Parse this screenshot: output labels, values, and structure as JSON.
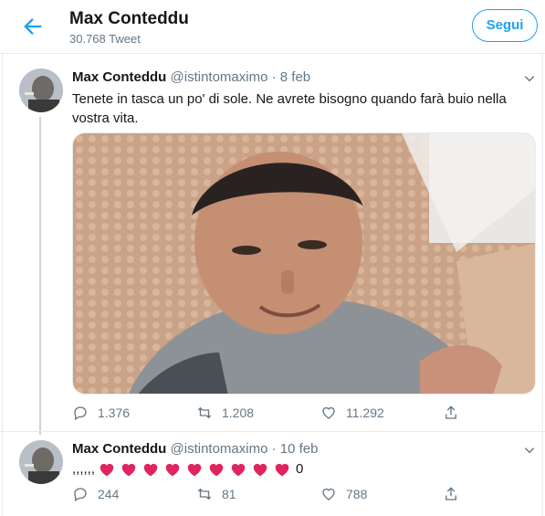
{
  "header": {
    "title": "Max Conteddu",
    "subtitle": "30.768 Tweet",
    "follow_label": "Segui"
  },
  "tweets": [
    {
      "name": "Max Conteddu",
      "handle": "@istintomaximo",
      "separator": "·",
      "date": "8 feb",
      "text": "Tenete in tasca un po' di sole. Ne avrete bisogno quando farà buio nella vostra vita.",
      "replies": "1.376",
      "retweets": "1.208",
      "likes": "11.292"
    },
    {
      "name": "Max Conteddu",
      "handle": "@istintomaximo",
      "separator": "·",
      "date": "10 feb",
      "prefix": ",,,,,,",
      "heart_count": 9,
      "suffix": "0",
      "replies": "244",
      "retweets": "81",
      "likes": "788"
    }
  ],
  "colors": {
    "accent": "#1da1f2",
    "secondary_text": "#657786",
    "heart": "#e0245e"
  },
  "icons": [
    "back-arrow-icon",
    "chevron-down-icon",
    "reply-icon",
    "retweet-icon",
    "like-icon",
    "share-icon",
    "heart-emoji-icon"
  ]
}
